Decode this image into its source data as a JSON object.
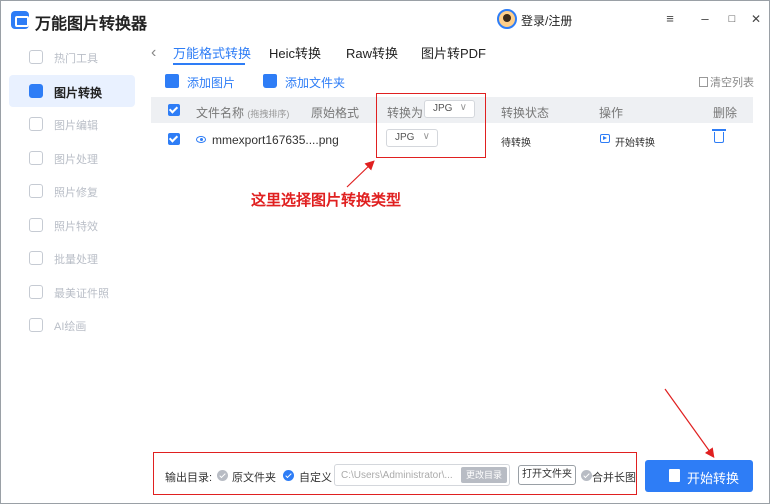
{
  "app": {
    "title": "万能图片转换器",
    "login": "登录/注册"
  },
  "window": {
    "menu_glyph": "≡",
    "min_glyph": "–",
    "max_glyph": "□",
    "close_glyph": "✕"
  },
  "sidebar": {
    "items": [
      {
        "label": "热门工具",
        "active": false
      },
      {
        "label": "图片转换",
        "active": true
      },
      {
        "label": "图片编辑",
        "active": false
      },
      {
        "label": "图片处理",
        "active": false
      },
      {
        "label": "照片修复",
        "active": false
      },
      {
        "label": "照片特效",
        "active": false
      },
      {
        "label": "批量处理",
        "active": false
      },
      {
        "label": "最美证件照",
        "active": false
      },
      {
        "label": "AI绘画",
        "active": false
      }
    ]
  },
  "tabs": [
    {
      "label": "万能格式转换",
      "active": true
    },
    {
      "label": "Heic转换",
      "active": false
    },
    {
      "label": "Raw转换",
      "active": false
    },
    {
      "label": "图片转PDF",
      "active": false
    }
  ],
  "toolbar": {
    "add_image": "添加图片",
    "add_folder": "添加文件夹",
    "clear_list": "清空列表"
  },
  "table": {
    "headers": {
      "filename": "文件名称",
      "filename_sort": "(拖拽排序)",
      "original_format": "原始格式",
      "convert_to": "转换为",
      "convert_to_value": "JPG",
      "status": "转换状态",
      "action": "操作",
      "delete": "删除"
    },
    "rows": [
      {
        "filename": "mmexport167635....png",
        "format": "JPG",
        "status": "待转换",
        "action": "开始转换"
      }
    ]
  },
  "annotation": {
    "text": "这里选择图片转换类型"
  },
  "bottom": {
    "output_label": "输出目录:",
    "option_original": "原文件夹",
    "option_custom": "自定义",
    "path_value": "C:\\Users\\Administrator\\...",
    "change_dir": "更改目录",
    "open_folder": "打开文件夹",
    "merge": "合并长图",
    "start": "开始转换"
  },
  "colors": {
    "accent": "#2e7df6",
    "annotation": "#e02020"
  }
}
